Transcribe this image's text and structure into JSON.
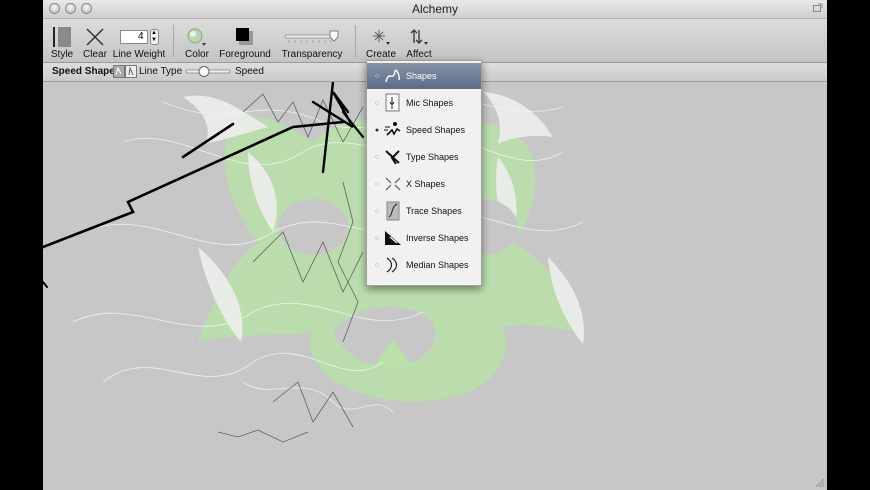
{
  "window": {
    "title": "Alchemy"
  },
  "toolbar": {
    "style_label": "Style",
    "clear_label": "Clear",
    "line_weight_label": "Line Weight",
    "line_weight_value": "4",
    "color_label": "Color",
    "foreground_label": "Foreground",
    "transparency_label": "Transparency",
    "create_label": "Create",
    "affect_label": "Affect"
  },
  "subbar": {
    "title": "Speed Shapes",
    "line_type_label": "Line Type",
    "speed_label": "Speed"
  },
  "menu": {
    "items": [
      {
        "label": "Shapes",
        "icon": "shapes-icon",
        "selected": true
      },
      {
        "label": "Mic Shapes",
        "icon": "mic-shapes-icon"
      },
      {
        "label": "Speed Shapes",
        "icon": "speed-shapes-icon",
        "active": true
      },
      {
        "label": "Type Shapes",
        "icon": "type-shapes-icon"
      },
      {
        "label": "X Shapes",
        "icon": "x-shapes-icon"
      },
      {
        "label": "Trace Shapes",
        "icon": "trace-shapes-icon"
      },
      {
        "label": "Inverse Shapes",
        "icon": "inverse-shapes-icon"
      },
      {
        "label": "Median Shapes",
        "icon": "median-shapes-icon"
      }
    ]
  },
  "colors": {
    "canvas": "#c7c7c7",
    "menu_highlight": "#6a7892",
    "green_shape": "#b8e0a8"
  }
}
